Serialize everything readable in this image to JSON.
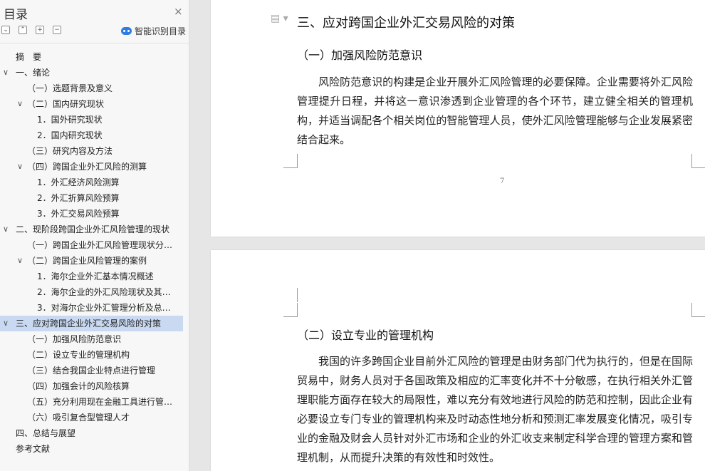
{
  "sidebar": {
    "title": "目录",
    "close_glyph": "×",
    "tools": [
      "−",
      "+",
      "+",
      "−"
    ],
    "smart_label": "智能识别目录",
    "toc": [
      {
        "label": "摘　要",
        "level": 0,
        "chev": ""
      },
      {
        "label": "一、绪论",
        "level": 0,
        "chev": "∨"
      },
      {
        "label": "（一）选题背景及意义",
        "level": 1,
        "chev": ""
      },
      {
        "label": "（二）国内研究现状",
        "level": 1,
        "chev": "∨"
      },
      {
        "label": "1．国外研究现状",
        "level": 2,
        "chev": ""
      },
      {
        "label": "2．国内研究现状",
        "level": 2,
        "chev": ""
      },
      {
        "label": "（三）研究内容及方法",
        "level": 1,
        "chev": ""
      },
      {
        "label": "（四）跨国企业外汇风险的测算",
        "level": 1,
        "chev": "∨"
      },
      {
        "label": "1．外汇经济风险测算",
        "level": 2,
        "chev": ""
      },
      {
        "label": "2．外汇折算风险预算",
        "level": 2,
        "chev": ""
      },
      {
        "label": "3．外汇交易风险预算",
        "level": 2,
        "chev": ""
      },
      {
        "label": "二、现阶段跨国企业外汇风险管理的现状",
        "level": 0,
        "chev": "∨"
      },
      {
        "label": "（一）跨国企业外汇风险管理现状分…",
        "level": 1,
        "chev": ""
      },
      {
        "label": "（二）跨国企业风险管理的案例",
        "level": 1,
        "chev": "∨"
      },
      {
        "label": "1．海尔企业外汇基本情况概述",
        "level": 2,
        "chev": ""
      },
      {
        "label": "2．海尔企业的外汇风险现状及其…",
        "level": 2,
        "chev": ""
      },
      {
        "label": "3．对海尔企业外汇管理分析及总…",
        "level": 2,
        "chev": ""
      },
      {
        "label": "三、应对跨国企业外汇交易风险的对策",
        "level": 0,
        "chev": "∨",
        "active": true
      },
      {
        "label": "（一）加强风险防范意识",
        "level": 1,
        "chev": ""
      },
      {
        "label": "（二）设立专业的管理机构",
        "level": 1,
        "chev": ""
      },
      {
        "label": "（三）结合我国企业特点进行管理",
        "level": 1,
        "chev": ""
      },
      {
        "label": "（四）加强会计的风险核算",
        "level": 1,
        "chev": ""
      },
      {
        "label": "（五）充分利用现在金融工具进行管…",
        "level": 1,
        "chev": ""
      },
      {
        "label": "（六）吸引复合型管理人才",
        "level": 1,
        "chev": ""
      },
      {
        "label": "四、总结与展望",
        "level": 0,
        "chev": ""
      },
      {
        "label": "参考文献",
        "level": 0,
        "chev": ""
      }
    ]
  },
  "document": {
    "page1": {
      "heading": "三、应对跨国企业外汇交易风险的对策",
      "subheading": "（一）加强风险防范意识",
      "paragraph": "风险防范意识的构建是企业开展外汇风险管理的必要保障。企业需要将外汇风险管理提升日程，并将这一意识渗透到企业管理的各个环节，建立健全相关的管理机构，并适当调配各个相关岗位的智能管理人员，使外汇风险管理能够与企业发展紧密结合起来。",
      "page_number": "7"
    },
    "page2": {
      "subheading": "（二）设立专业的管理机构",
      "paragraph": "我国的许多跨国企业目前外汇风险的管理是由财务部门代为执行的，但是在国际贸易中，财务人员对于各国政策及相应的汇率变化并不十分敏感，在执行相关外汇管理职能方面存在较大的局限性，难以充分有效地进行风险的防范和控制，因此企业有必要设立专门专业的管理机构来及时动态性地分析和预测汇率发展变化情况，吸引专业的金融及财会人员针对外汇市场和企业的外汇收支来制定科学合理的管理方案和管理机制，从而提升决策的有效性和时效性。"
    }
  }
}
